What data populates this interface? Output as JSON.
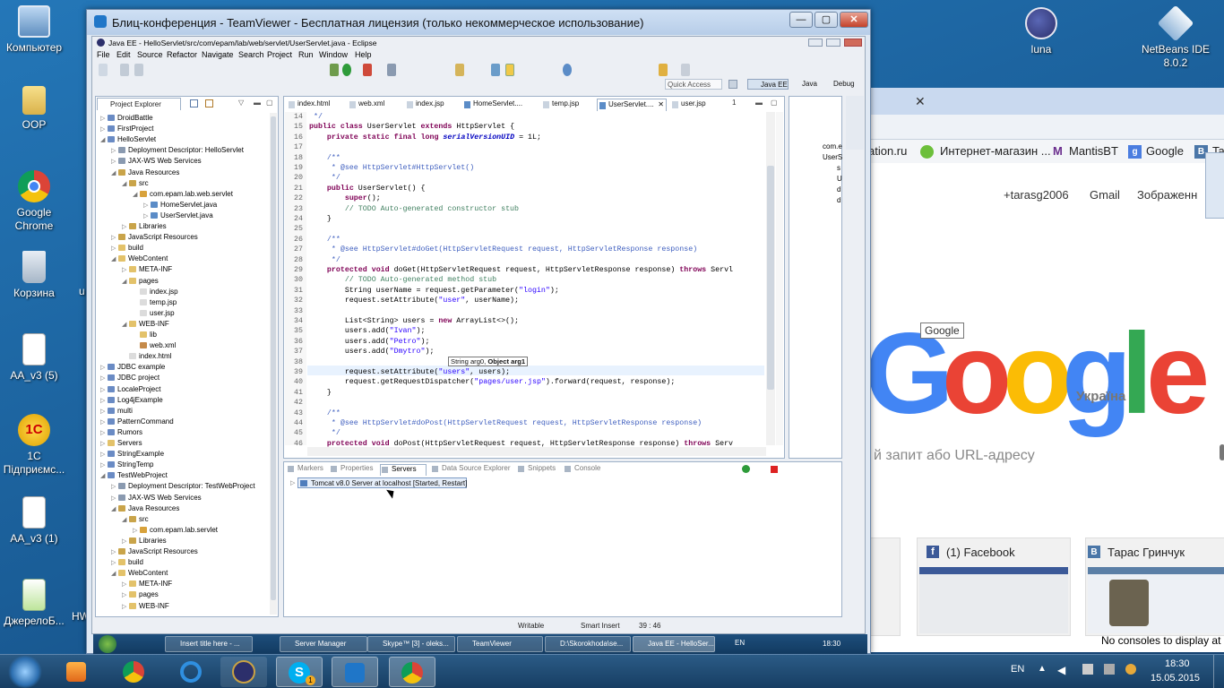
{
  "desktop_icons": [
    {
      "label": "Компьютер",
      "icon": "computer-icon"
    },
    {
      "label": "OOP",
      "icon": "folder-icon"
    },
    {
      "label": "Google Chrome",
      "icon": "chrome-icon"
    },
    {
      "label": "Корзина",
      "icon": "recycle-bin-icon"
    },
    {
      "label": "AA_v3 (5)",
      "icon": "document-icon"
    },
    {
      "label": "1С Підприємс...",
      "icon": "1c-icon"
    },
    {
      "label": "AA_v3 (1)",
      "icon": "document-icon"
    },
    {
      "label": "ДжерелоБ...",
      "icon": "document-icon"
    },
    {
      "label": "luna",
      "icon": "eclipse-icon"
    },
    {
      "label": "NetBeans IDE 8.0.2",
      "icon": "netbeans-icon"
    }
  ],
  "desktop_fragments": {
    "u": "u",
    "hw": "HW"
  },
  "teamviewer": {
    "title": "Блиц-конференция - TeamViewer - Бесплатная лицензия (только некоммерческое использование)"
  },
  "eclipse": {
    "title": "Java EE - HelloServlet/src/com/epam/lab/web/servlet/UserServlet.java - Eclipse",
    "menu": [
      "File",
      "Edit",
      "Source",
      "Refactor",
      "Navigate",
      "Search",
      "Project",
      "Run",
      "Window",
      "Help"
    ],
    "quick_access": "Quick Access",
    "perspectives": [
      "Java EE",
      "Java",
      "Debug"
    ],
    "project_explorer": {
      "title": "Project Explorer",
      "items": [
        "DroidBattle",
        "FirstProject",
        "HelloServlet",
        "Deployment Descriptor: HelloServlet",
        "JAX-WS Web Services",
        "Java Resources",
        "src",
        "com.epam.lab.web.servlet",
        "HomeServlet.java",
        "UserServlet.java",
        "Libraries",
        "JavaScript Resources",
        "build",
        "WebContent",
        "META-INF",
        "pages",
        "index.jsp",
        "temp.jsp",
        "user.jsp",
        "WEB-INF",
        "lib",
        "web.xml",
        "index.html",
        "JDBC example",
        "JDBC project",
        "LocaleProject",
        "Log4jExample",
        "multi",
        "PatternCommand",
        "Rumors",
        "Servers",
        "StringExample",
        "StringTemp",
        "TestWebProject",
        "Deployment Descriptor: TestWebProject",
        "JAX-WS Web Services",
        "Java Resources",
        "src",
        "com.epam.lab.servlet",
        "Libraries",
        "JavaScript Resources",
        "build",
        "WebContent",
        "META-INF",
        "pages",
        "WEB-INF"
      ]
    },
    "editor_tabs": [
      "index.html",
      "web.xml",
      "index.jsp",
      "HomeServlet....",
      "temp.jsp",
      "UserServlet....",
      "user.jsp"
    ],
    "editor_tab_overflow": "1",
    "code_lines": [
      {
        "n": "14",
        "t": " */"
      },
      {
        "n": "15",
        "t": "public class UserServlet extends HttpServlet {"
      },
      {
        "n": "16",
        "t": "    private static final long serialVersionUID = 1L;"
      },
      {
        "n": "17",
        "t": ""
      },
      {
        "n": "18",
        "t": "    /**"
      },
      {
        "n": "19",
        "t": "     * @see HttpServlet#HttpServlet()"
      },
      {
        "n": "20",
        "t": "     */"
      },
      {
        "n": "21",
        "t": "    public UserServlet() {"
      },
      {
        "n": "22",
        "t": "        super();"
      },
      {
        "n": "23",
        "t": "        // TODO Auto-generated constructor stub"
      },
      {
        "n": "24",
        "t": "    }"
      },
      {
        "n": "25",
        "t": ""
      },
      {
        "n": "26",
        "t": "    /**"
      },
      {
        "n": "27",
        "t": "     * @see HttpServlet#doGet(HttpServletRequest request, HttpServletResponse response)"
      },
      {
        "n": "28",
        "t": "     */"
      },
      {
        "n": "29",
        "t": "    protected void doGet(HttpServletRequest request, HttpServletResponse response) throws Servl"
      },
      {
        "n": "30",
        "t": "        // TODO Auto-generated method stub"
      },
      {
        "n": "31",
        "t": "        String userName = request.getParameter(\"login\");"
      },
      {
        "n": "32",
        "t": "        request.setAttribute(\"user\", userName);"
      },
      {
        "n": "33",
        "t": ""
      },
      {
        "n": "34",
        "t": "        List<String> users = new ArrayList<>();"
      },
      {
        "n": "35",
        "t": "        users.add(\"Ivan\");"
      },
      {
        "n": "36",
        "t": "        users.add(\"Petro\");"
      },
      {
        "n": "37",
        "t": "        users.add(\"Dmytro\");"
      },
      {
        "n": "38",
        "t": ""
      },
      {
        "n": "39",
        "t": "        request.setAttribute(\"users\", users);"
      },
      {
        "n": "40",
        "t": "        request.getRequestDispatcher(\"pages/user.jsp\").forward(request, response);"
      },
      {
        "n": "41",
        "t": "    }"
      },
      {
        "n": "42",
        "t": ""
      },
      {
        "n": "43",
        "t": "    /**"
      },
      {
        "n": "44",
        "t": "     * @see HttpServlet#doPost(HttpServletRequest request, HttpServletResponse response)"
      },
      {
        "n": "45",
        "t": "     */"
      },
      {
        "n": "46",
        "t": "    protected void doPost(HttpServletRequest request, HttpServletResponse response) throws Serv"
      }
    ],
    "hint": {
      "a": "String arg0, ",
      "b": "Object arg1"
    },
    "outline_fragments": [
      "com.e",
      "UserS",
      "s",
      "U",
      "d",
      "d"
    ],
    "bottom_tabs": [
      "Markers",
      "Properties",
      "Servers",
      "Data Source Explorer",
      "Snippets",
      "Console"
    ],
    "server_entry": "Tomcat v8.0 Server at localhost  [Started, Restart]",
    "status": {
      "writable": "Writable",
      "insert": "Smart Insert",
      "pos": "39 : 46"
    }
  },
  "chrome": {
    "bookmarks": [
      "ation.ru",
      "Интернет-магазин ...",
      "MantisBT",
      "Google",
      "Ta"
    ],
    "links": {
      "user": "+tarasg2006",
      "gmail": "Gmail",
      "images": "Зображенн"
    },
    "tooltip": "Google",
    "logo_letters": [
      "G",
      "o",
      "o",
      "g",
      "l",
      "e"
    ],
    "country": "Україна",
    "omnibox": "й запит або URL-адресу",
    "tiles": [
      "(1) Facebook",
      "Тарас Гринчук"
    ],
    "console_msg": "No consoles to display at",
    "colors": {
      "blue": "#4285f4",
      "red": "#ea4335",
      "yellow": "#fbbc05",
      "green": "#34a853"
    }
  },
  "inner_taskbar": {
    "items": [
      "Insert title here - ...",
      "Server Manager",
      "Skype™ [3] - oleks...",
      "TeamViewer",
      "D:\\Skorokhoda\\se...",
      "Java EE - HelloSer..."
    ],
    "lang": "EN",
    "time": "18:30"
  },
  "taskbar": {
    "pinned": [
      "windows-media-player-icon",
      "chrome-icon",
      "internet-explorer-icon",
      "java-ee-ide-icon",
      "skype-icon",
      "teamviewer-icon",
      "chrome-icon"
    ],
    "skype_badge": "1",
    "lang": "EN",
    "time": "18:30",
    "date": "15.05.2015"
  }
}
